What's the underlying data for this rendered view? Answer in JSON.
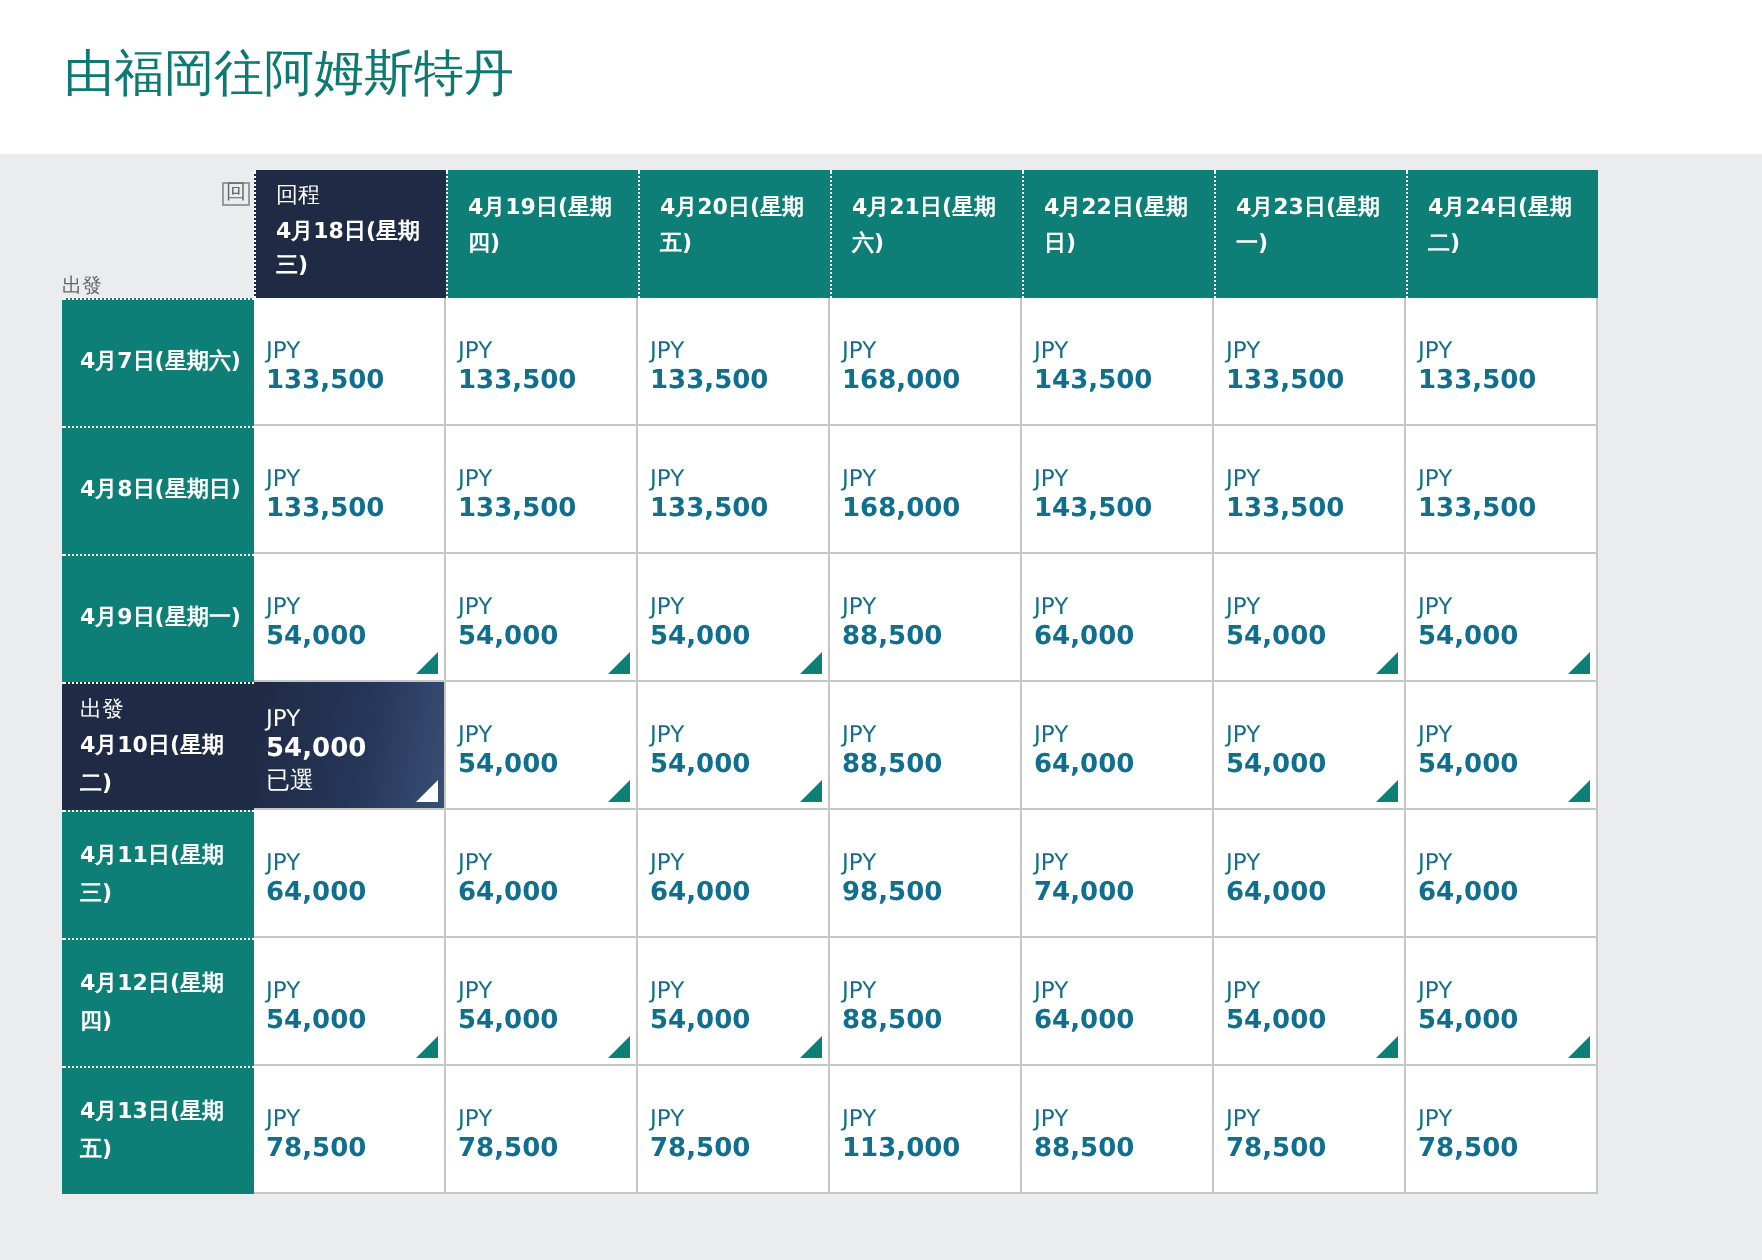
{
  "title": "由福岡往阿姆斯特丹",
  "corner": {
    "return_label": "回",
    "depart_label": "出發"
  },
  "return_dates": [
    {
      "prefix": "回程",
      "date": "4月18日(星期三)",
      "selected": true
    },
    {
      "date": "4月19日(星期四)",
      "selected": false
    },
    {
      "date": "4月20日(星期五)",
      "selected": false
    },
    {
      "date": "4月21日(星期六)",
      "selected": false
    },
    {
      "date": "4月22日(星期日)",
      "selected": false
    },
    {
      "date": "4月23日(星期一)",
      "selected": false
    },
    {
      "date": "4月24日(星期二)",
      "selected": false
    }
  ],
  "rows": [
    {
      "date": "4月7日(星期六)",
      "selected": false,
      "fares": [
        {
          "currency": "JPY",
          "amount": "133,500",
          "lowest": false,
          "selected": false
        },
        {
          "currency": "JPY",
          "amount": "133,500",
          "lowest": false,
          "selected": false
        },
        {
          "currency": "JPY",
          "amount": "133,500",
          "lowest": false,
          "selected": false
        },
        {
          "currency": "JPY",
          "amount": "168,000",
          "lowest": false,
          "selected": false
        },
        {
          "currency": "JPY",
          "amount": "143,500",
          "lowest": false,
          "selected": false
        },
        {
          "currency": "JPY",
          "amount": "133,500",
          "lowest": false,
          "selected": false
        },
        {
          "currency": "JPY",
          "amount": "133,500",
          "lowest": false,
          "selected": false
        }
      ]
    },
    {
      "date": "4月8日(星期日)",
      "selected": false,
      "fares": [
        {
          "currency": "JPY",
          "amount": "133,500",
          "lowest": false,
          "selected": false
        },
        {
          "currency": "JPY",
          "amount": "133,500",
          "lowest": false,
          "selected": false
        },
        {
          "currency": "JPY",
          "amount": "133,500",
          "lowest": false,
          "selected": false
        },
        {
          "currency": "JPY",
          "amount": "168,000",
          "lowest": false,
          "selected": false
        },
        {
          "currency": "JPY",
          "amount": "143,500",
          "lowest": false,
          "selected": false
        },
        {
          "currency": "JPY",
          "amount": "133,500",
          "lowest": false,
          "selected": false
        },
        {
          "currency": "JPY",
          "amount": "133,500",
          "lowest": false,
          "selected": false
        }
      ]
    },
    {
      "date": "4月9日(星期一)",
      "selected": false,
      "fares": [
        {
          "currency": "JPY",
          "amount": "54,000",
          "lowest": true,
          "selected": false
        },
        {
          "currency": "JPY",
          "amount": "54,000",
          "lowest": true,
          "selected": false
        },
        {
          "currency": "JPY",
          "amount": "54,000",
          "lowest": true,
          "selected": false
        },
        {
          "currency": "JPY",
          "amount": "88,500",
          "lowest": false,
          "selected": false
        },
        {
          "currency": "JPY",
          "amount": "64,000",
          "lowest": false,
          "selected": false
        },
        {
          "currency": "JPY",
          "amount": "54,000",
          "lowest": true,
          "selected": false
        },
        {
          "currency": "JPY",
          "amount": "54,000",
          "lowest": true,
          "selected": false
        }
      ]
    },
    {
      "prefix": "出發",
      "date": "4月10日(星期二)",
      "selected": true,
      "fares": [
        {
          "currency": "JPY",
          "amount": "54,000",
          "note": "已選",
          "lowest": true,
          "selected": true
        },
        {
          "currency": "JPY",
          "amount": "54,000",
          "lowest": true,
          "selected": false
        },
        {
          "currency": "JPY",
          "amount": "54,000",
          "lowest": true,
          "selected": false
        },
        {
          "currency": "JPY",
          "amount": "88,500",
          "lowest": false,
          "selected": false
        },
        {
          "currency": "JPY",
          "amount": "64,000",
          "lowest": false,
          "selected": false
        },
        {
          "currency": "JPY",
          "amount": "54,000",
          "lowest": true,
          "selected": false
        },
        {
          "currency": "JPY",
          "amount": "54,000",
          "lowest": true,
          "selected": false
        }
      ]
    },
    {
      "date": "4月11日(星期三)",
      "selected": false,
      "fares": [
        {
          "currency": "JPY",
          "amount": "64,000",
          "lowest": false,
          "selected": false
        },
        {
          "currency": "JPY",
          "amount": "64,000",
          "lowest": false,
          "selected": false
        },
        {
          "currency": "JPY",
          "amount": "64,000",
          "lowest": false,
          "selected": false
        },
        {
          "currency": "JPY",
          "amount": "98,500",
          "lowest": false,
          "selected": false
        },
        {
          "currency": "JPY",
          "amount": "74,000",
          "lowest": false,
          "selected": false
        },
        {
          "currency": "JPY",
          "amount": "64,000",
          "lowest": false,
          "selected": false
        },
        {
          "currency": "JPY",
          "amount": "64,000",
          "lowest": false,
          "selected": false
        }
      ]
    },
    {
      "date": "4月12日(星期四)",
      "selected": false,
      "fares": [
        {
          "currency": "JPY",
          "amount": "54,000",
          "lowest": true,
          "selected": false
        },
        {
          "currency": "JPY",
          "amount": "54,000",
          "lowest": true,
          "selected": false
        },
        {
          "currency": "JPY",
          "amount": "54,000",
          "lowest": true,
          "selected": false
        },
        {
          "currency": "JPY",
          "amount": "88,500",
          "lowest": false,
          "selected": false
        },
        {
          "currency": "JPY",
          "amount": "64,000",
          "lowest": false,
          "selected": false
        },
        {
          "currency": "JPY",
          "amount": "54,000",
          "lowest": true,
          "selected": false
        },
        {
          "currency": "JPY",
          "amount": "54,000",
          "lowest": true,
          "selected": false
        }
      ]
    },
    {
      "date": "4月13日(星期五)",
      "selected": false,
      "fares": [
        {
          "currency": "JPY",
          "amount": "78,500",
          "lowest": false,
          "selected": false
        },
        {
          "currency": "JPY",
          "amount": "78,500",
          "lowest": false,
          "selected": false
        },
        {
          "currency": "JPY",
          "amount": "78,500",
          "lowest": false,
          "selected": false
        },
        {
          "currency": "JPY",
          "amount": "113,000",
          "lowest": false,
          "selected": false
        },
        {
          "currency": "JPY",
          "amount": "88,500",
          "lowest": false,
          "selected": false
        },
        {
          "currency": "JPY",
          "amount": "78,500",
          "lowest": false,
          "selected": false
        },
        {
          "currency": "JPY",
          "amount": "78,500",
          "lowest": false,
          "selected": false
        }
      ]
    }
  ]
}
